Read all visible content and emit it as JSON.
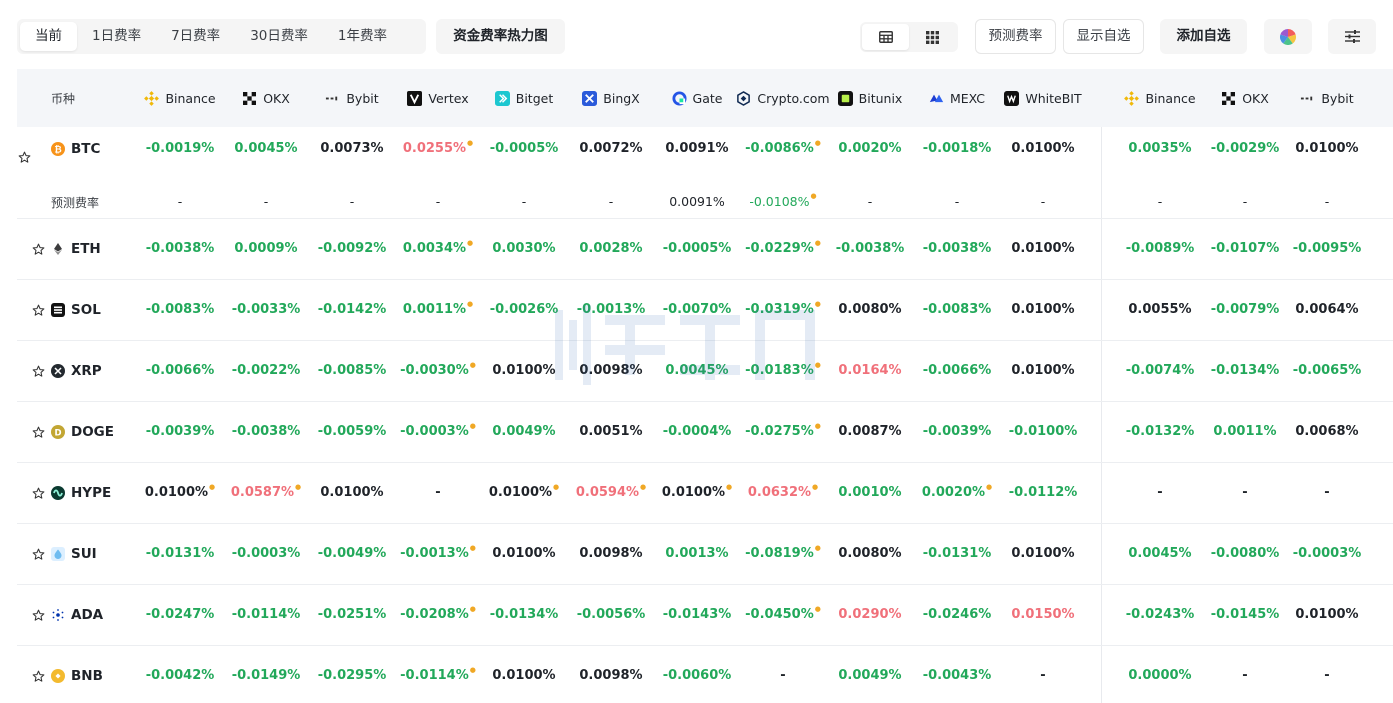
{
  "toolbar": {
    "tabs": [
      {
        "label": "当前",
        "active": true
      },
      {
        "label": "1日费率",
        "active": false
      },
      {
        "label": "7日费率",
        "active": false
      },
      {
        "label": "30日费率",
        "active": false
      },
      {
        "label": "1年费率",
        "active": false
      }
    ],
    "heatmap_label": "资金费率热力图",
    "predicted_label": "预测费率",
    "show_fav_label": "显示自选",
    "add_fav_label": "添加自选"
  },
  "table": {
    "coin_header": "币种",
    "exchanges": [
      {
        "name": "Binance",
        "icon": "binance-icon"
      },
      {
        "name": "OKX",
        "icon": "okx-icon"
      },
      {
        "name": "Bybit",
        "icon": "bybit-icon"
      },
      {
        "name": "Vertex",
        "icon": "vertex-icon"
      },
      {
        "name": "Bitget",
        "icon": "bitget-icon"
      },
      {
        "name": "BingX",
        "icon": "bingx-icon"
      },
      {
        "name": "Gate",
        "icon": "gate-icon"
      },
      {
        "name": "Crypto.com",
        "icon": "cryptocom-icon"
      },
      {
        "name": "Bitunix",
        "icon": "bitunix-icon"
      },
      {
        "name": "MEXC",
        "icon": "mexc-icon"
      },
      {
        "name": "WhiteBIT",
        "icon": "whitebit-icon"
      },
      {
        "name": "Binance",
        "icon": "binance-icon"
      },
      {
        "name": "OKX",
        "icon": "okx-icon"
      },
      {
        "name": "Bybit",
        "icon": "bybit-icon"
      }
    ],
    "predicted_row_label": "预测费率",
    "rows": [
      {
        "coin": "BTC",
        "icon_color": "#f7931a",
        "rates": [
          [
            "-0.0019%",
            "g",
            false
          ],
          [
            "0.0045%",
            "g",
            false
          ],
          [
            "0.0073%",
            "n",
            false
          ],
          [
            "0.0255%",
            "r",
            true
          ],
          [
            "-0.0005%",
            "g",
            false
          ],
          [
            "0.0072%",
            "n",
            false
          ],
          [
            "0.0091%",
            "n",
            false
          ],
          [
            "-0.0086%",
            "g",
            true
          ],
          [
            "0.0020%",
            "g",
            false
          ],
          [
            "-0.0018%",
            "g",
            false
          ],
          [
            "0.0100%",
            "n",
            false
          ],
          [
            "0.0035%",
            "g",
            false
          ],
          [
            "-0.0029%",
            "g",
            false
          ],
          [
            "0.0100%",
            "n",
            false
          ]
        ],
        "predicted": [
          [
            "-",
            "n",
            false
          ],
          [
            "-",
            "n",
            false
          ],
          [
            "-",
            "n",
            false
          ],
          [
            "-",
            "n",
            false
          ],
          [
            "-",
            "n",
            false
          ],
          [
            "-",
            "n",
            false
          ],
          [
            "0.0091%",
            "n",
            false
          ],
          [
            "-0.0108%",
            "g",
            true
          ],
          [
            "-",
            "n",
            false
          ],
          [
            "-",
            "n",
            false
          ],
          [
            "-",
            "n",
            false
          ],
          [
            "-",
            "n",
            false
          ],
          [
            "-",
            "n",
            false
          ],
          [
            "-",
            "n",
            false
          ]
        ]
      },
      {
        "coin": "ETH",
        "icon_color": "#3c3c3d",
        "rates": [
          [
            "-0.0038%",
            "g",
            false
          ],
          [
            "0.0009%",
            "g",
            false
          ],
          [
            "-0.0092%",
            "g",
            false
          ],
          [
            "0.0034%",
            "g",
            true
          ],
          [
            "0.0030%",
            "g",
            false
          ],
          [
            "0.0028%",
            "g",
            false
          ],
          [
            "-0.0005%",
            "g",
            false
          ],
          [
            "-0.0229%",
            "g",
            true
          ],
          [
            "-0.0038%",
            "g",
            false
          ],
          [
            "-0.0038%",
            "g",
            false
          ],
          [
            "0.0100%",
            "n",
            false
          ],
          [
            "-0.0089%",
            "g",
            false
          ],
          [
            "-0.0107%",
            "g",
            false
          ],
          [
            "-0.0095%",
            "g",
            false
          ]
        ]
      },
      {
        "coin": "SOL",
        "icon_color": "#111111",
        "rates": [
          [
            "-0.0083%",
            "g",
            false
          ],
          [
            "-0.0033%",
            "g",
            false
          ],
          [
            "-0.0142%",
            "g",
            false
          ],
          [
            "0.0011%",
            "g",
            true
          ],
          [
            "-0.0026%",
            "g",
            false
          ],
          [
            "-0.0013%",
            "g",
            false
          ],
          [
            "-0.0070%",
            "g",
            false
          ],
          [
            "-0.0319%",
            "g",
            true
          ],
          [
            "0.0080%",
            "n",
            false
          ],
          [
            "-0.0083%",
            "g",
            false
          ],
          [
            "0.0100%",
            "n",
            false
          ],
          [
            "0.0055%",
            "n",
            false
          ],
          [
            "-0.0079%",
            "g",
            false
          ],
          [
            "0.0064%",
            "n",
            false
          ]
        ]
      },
      {
        "coin": "XRP",
        "icon_color": "#23292f",
        "rates": [
          [
            "-0.0066%",
            "g",
            false
          ],
          [
            "-0.0022%",
            "g",
            false
          ],
          [
            "-0.0085%",
            "g",
            false
          ],
          [
            "-0.0030%",
            "g",
            true
          ],
          [
            "0.0100%",
            "n",
            false
          ],
          [
            "0.0098%",
            "n",
            false
          ],
          [
            "0.0045%",
            "g",
            false
          ],
          [
            "-0.0183%",
            "g",
            true
          ],
          [
            "0.0164%",
            "r",
            false
          ],
          [
            "-0.0066%",
            "g",
            false
          ],
          [
            "0.0100%",
            "n",
            false
          ],
          [
            "-0.0074%",
            "g",
            false
          ],
          [
            "-0.0134%",
            "g",
            false
          ],
          [
            "-0.0065%",
            "g",
            false
          ]
        ]
      },
      {
        "coin": "DOGE",
        "icon_color": "#c2a633",
        "rates": [
          [
            "-0.0039%",
            "g",
            false
          ],
          [
            "-0.0038%",
            "g",
            false
          ],
          [
            "-0.0059%",
            "g",
            false
          ],
          [
            "-0.0003%",
            "g",
            true
          ],
          [
            "0.0049%",
            "g",
            false
          ],
          [
            "0.0051%",
            "n",
            false
          ],
          [
            "-0.0004%",
            "g",
            false
          ],
          [
            "-0.0275%",
            "g",
            true
          ],
          [
            "0.0087%",
            "n",
            false
          ],
          [
            "-0.0039%",
            "g",
            false
          ],
          [
            "-0.0100%",
            "g",
            false
          ],
          [
            "-0.0132%",
            "g",
            false
          ],
          [
            "0.0011%",
            "g",
            false
          ],
          [
            "0.0068%",
            "n",
            false
          ]
        ]
      },
      {
        "coin": "HYPE",
        "icon_color": "#0a3a30",
        "rates": [
          [
            "0.0100%",
            "n",
            true
          ],
          [
            "0.0587%",
            "r",
            true
          ],
          [
            "0.0100%",
            "n",
            false
          ],
          [
            "-",
            "n",
            false
          ],
          [
            "0.0100%",
            "n",
            true
          ],
          [
            "0.0594%",
            "r",
            true
          ],
          [
            "0.0100%",
            "n",
            true
          ],
          [
            "0.0632%",
            "r",
            true
          ],
          [
            "0.0010%",
            "g",
            false
          ],
          [
            "0.0020%",
            "g",
            true
          ],
          [
            "-0.0112%",
            "g",
            false
          ],
          [
            "-",
            "n",
            false
          ],
          [
            "-",
            "n",
            false
          ],
          [
            "-",
            "n",
            false
          ]
        ]
      },
      {
        "coin": "SUI",
        "icon_color": "#6fbcf0",
        "rates": [
          [
            "-0.0131%",
            "g",
            false
          ],
          [
            "-0.0003%",
            "g",
            false
          ],
          [
            "-0.0049%",
            "g",
            false
          ],
          [
            "-0.0013%",
            "g",
            true
          ],
          [
            "0.0100%",
            "n",
            false
          ],
          [
            "0.0098%",
            "n",
            false
          ],
          [
            "0.0013%",
            "g",
            false
          ],
          [
            "-0.0819%",
            "g",
            true
          ],
          [
            "0.0080%",
            "n",
            false
          ],
          [
            "-0.0131%",
            "g",
            false
          ],
          [
            "0.0100%",
            "n",
            false
          ],
          [
            "0.0045%",
            "g",
            false
          ],
          [
            "-0.0080%",
            "g",
            false
          ],
          [
            "-0.0003%",
            "g",
            false
          ]
        ]
      },
      {
        "coin": "ADA",
        "icon_color": "#0033ad",
        "rates": [
          [
            "-0.0247%",
            "g",
            false
          ],
          [
            "-0.0114%",
            "g",
            false
          ],
          [
            "-0.0251%",
            "g",
            false
          ],
          [
            "-0.0208%",
            "g",
            true
          ],
          [
            "-0.0134%",
            "g",
            false
          ],
          [
            "-0.0056%",
            "g",
            false
          ],
          [
            "-0.0143%",
            "g",
            false
          ],
          [
            "-0.0450%",
            "g",
            true
          ],
          [
            "0.0290%",
            "r",
            false
          ],
          [
            "-0.0246%",
            "g",
            false
          ],
          [
            "0.0150%",
            "r",
            false
          ],
          [
            "-0.0243%",
            "g",
            false
          ],
          [
            "-0.0145%",
            "g",
            false
          ],
          [
            "0.0100%",
            "n",
            false
          ]
        ]
      },
      {
        "coin": "BNB",
        "icon_color": "#f3ba2f",
        "rates": [
          [
            "-0.0042%",
            "g",
            false
          ],
          [
            "-0.0149%",
            "g",
            false
          ],
          [
            "-0.0295%",
            "g",
            false
          ],
          [
            "-0.0114%",
            "g",
            true
          ],
          [
            "0.0100%",
            "n",
            false
          ],
          [
            "0.0098%",
            "n",
            false
          ],
          [
            "-0.0060%",
            "g",
            false
          ],
          [
            "-",
            "n",
            false
          ],
          [
            "0.0049%",
            "g",
            false
          ],
          [
            "-0.0043%",
            "g",
            false
          ],
          [
            "-",
            "n",
            false
          ],
          [
            "0.0000%",
            "g",
            false
          ],
          [
            "-",
            "n",
            false
          ],
          [
            "-",
            "n",
            false
          ]
        ]
      }
    ]
  },
  "colors": {
    "green": "#22a85a",
    "red": "#f0707a",
    "neutral": "#1f2329",
    "header_bg": "#f4f6f9"
  }
}
